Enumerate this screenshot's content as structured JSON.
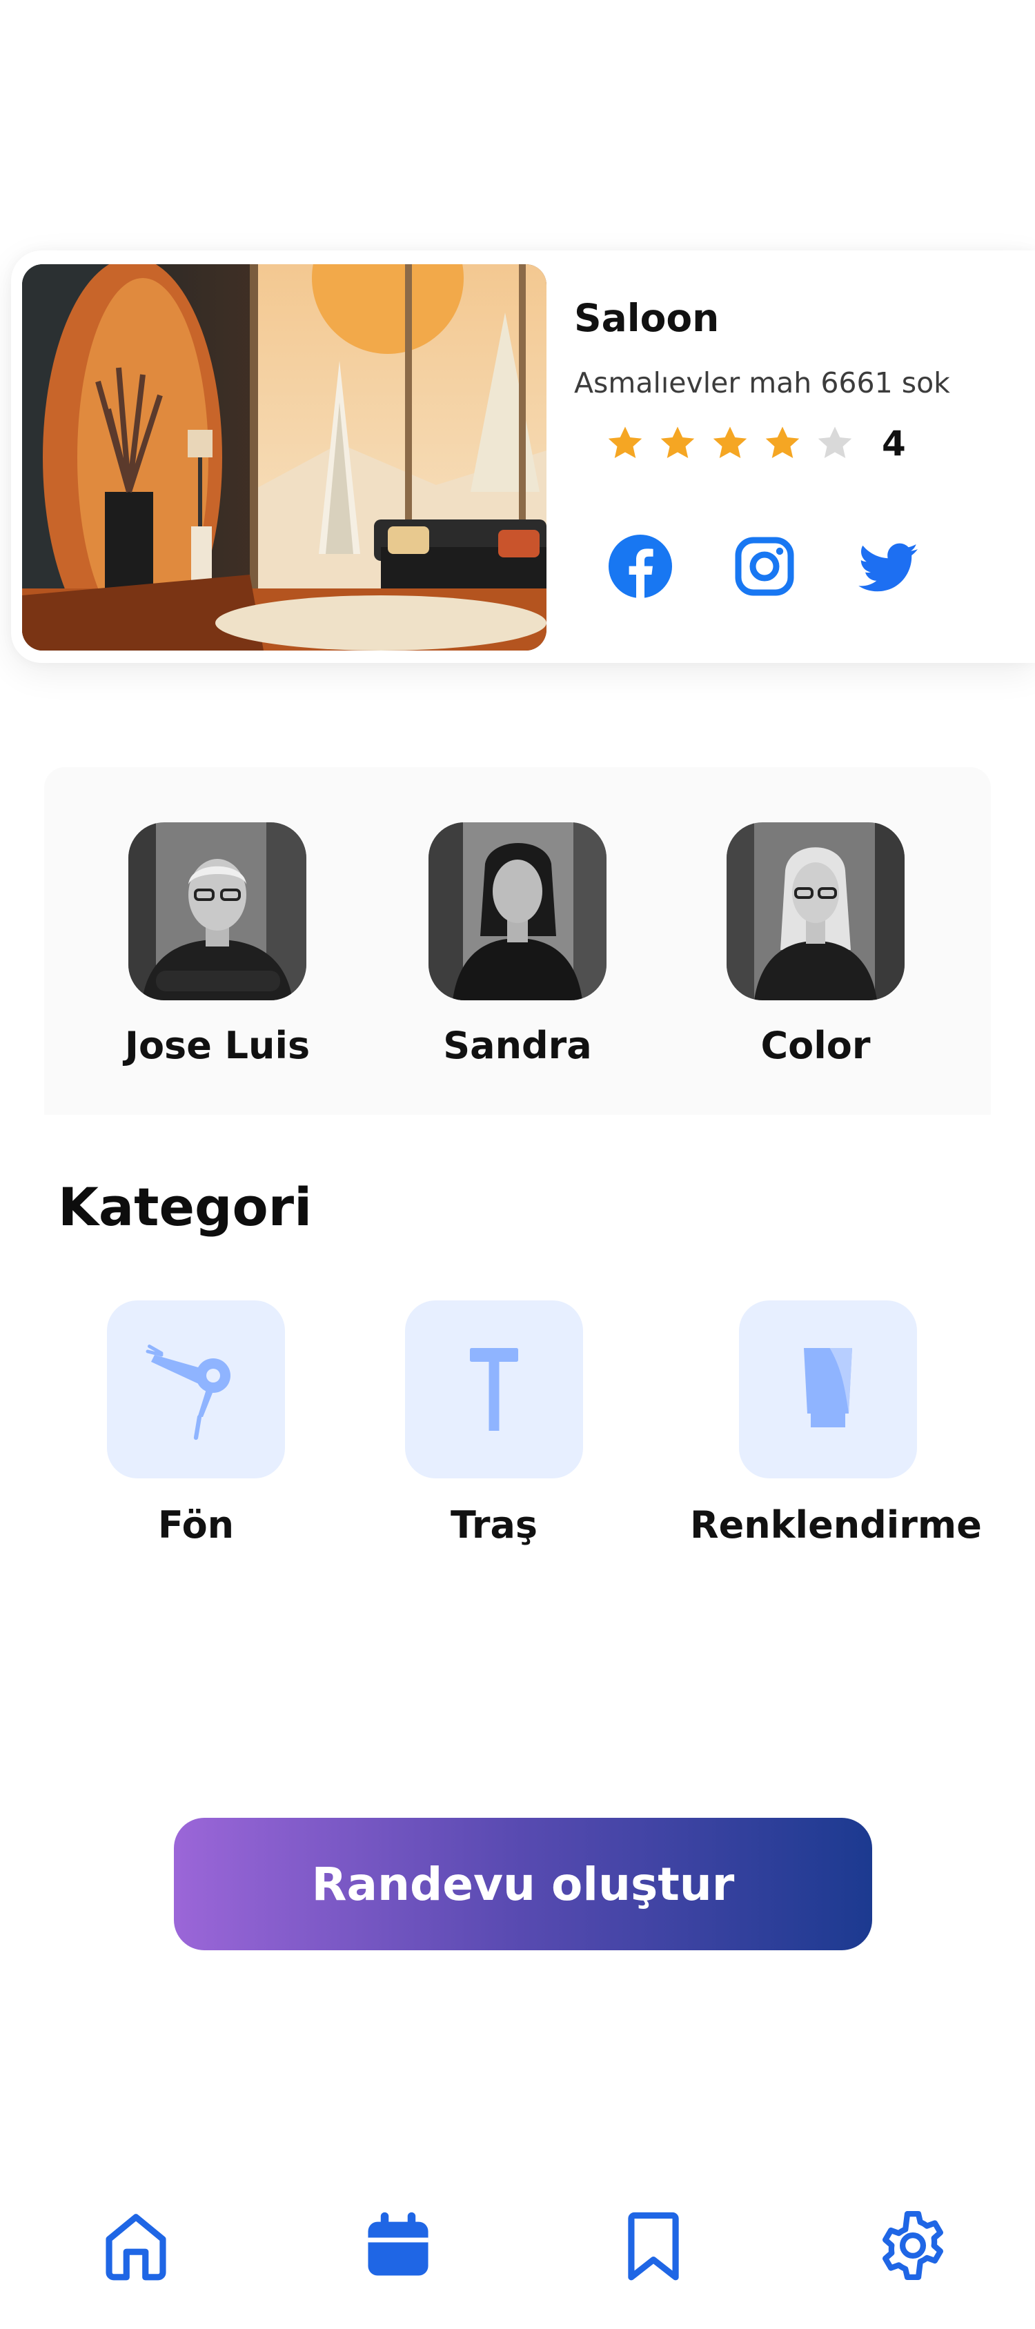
{
  "salon": {
    "name": "Saloon",
    "address": "Asmalıevler mah 6661 sok",
    "rating": 4,
    "rating_display": "4",
    "max_rating": 5,
    "image_icon": "salon-interior-image",
    "social": [
      {
        "name": "facebook",
        "icon": "facebook-icon",
        "color": "#1877f2"
      },
      {
        "name": "instagram",
        "icon": "instagram-icon",
        "color": "#1877f2"
      },
      {
        "name": "twitter",
        "icon": "twitter-icon",
        "color": "#1d6ff2"
      }
    ],
    "star_color": "#f5a623",
    "star_empty_color": "#d9d9d9"
  },
  "staff": [
    {
      "name": "Jose Luis"
    },
    {
      "name": "Sandra"
    },
    {
      "name": "Color"
    }
  ],
  "categories_section": {
    "title": "Kategori",
    "items": [
      {
        "label": "Fön",
        "icon": "hair-dryer-icon"
      },
      {
        "label": "Traş",
        "icon": "razor-icon"
      },
      {
        "label": "Renklendirme",
        "icon": "hair-color-tube-icon"
      }
    ],
    "tile_color": "#e7efff",
    "icon_color": "#8fb4ff"
  },
  "cta": {
    "label": "Randevu oluştur"
  },
  "bottom_nav": {
    "items": [
      {
        "name": "home",
        "icon": "home-icon"
      },
      {
        "name": "calendar",
        "icon": "calendar-icon"
      },
      {
        "name": "bookmark",
        "icon": "bookmark-icon"
      },
      {
        "name": "settings",
        "icon": "settings-gear-icon"
      }
    ],
    "accent_color": "#1f66e5"
  }
}
